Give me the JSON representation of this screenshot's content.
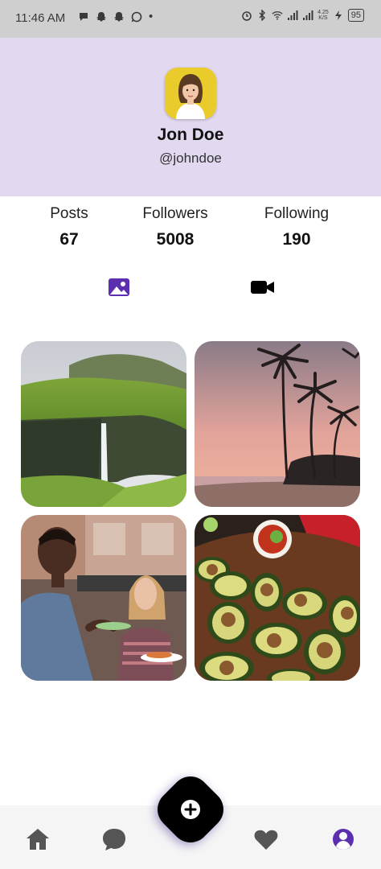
{
  "status_bar": {
    "time": "11:46 AM",
    "dot": "•",
    "network_top": "4.25",
    "network_bottom": "K/S",
    "battery": "95",
    "left_icons": [
      "message-bubble-icon",
      "snapchat-icon",
      "snapchat-icon",
      "whatsapp-icon"
    ],
    "right_icons": [
      "alarm-icon",
      "bluetooth-icon",
      "wifi-icon",
      "signal-icon",
      "signal-icon",
      "charging-icon",
      "battery-icon"
    ]
  },
  "profile": {
    "name": "Jon Doe",
    "handle": "@johndoe"
  },
  "stats": [
    {
      "label": "Posts",
      "value": "67"
    },
    {
      "label": "Followers",
      "value": "5008"
    },
    {
      "label": "Following",
      "value": "190"
    }
  ],
  "media_tabs": [
    {
      "icon": "image-icon",
      "active": true,
      "color": "#5b2fb0"
    },
    {
      "icon": "video-icon",
      "active": false,
      "color": "#000000"
    }
  ],
  "posts": [
    {
      "subject": "green cliffs with waterfall",
      "icon": "photo-thumbnail"
    },
    {
      "subject": "palm trees at sunset beach",
      "icon": "photo-thumbnail"
    },
    {
      "subject": "two people eating pizza outdoors",
      "icon": "photo-thumbnail"
    },
    {
      "subject": "halved avocados on wooden board",
      "icon": "photo-thumbnail"
    }
  ],
  "bottom_nav": {
    "items": [
      "home-icon",
      "chat-icon",
      "heart-icon",
      "profile-icon"
    ],
    "active": "profile-icon",
    "fab_icon": "plus-icon"
  },
  "colors": {
    "header_bg": "#e2d8f0",
    "accent": "#5b2fb0",
    "nav_icon": "#555555",
    "fab": "#000000"
  }
}
